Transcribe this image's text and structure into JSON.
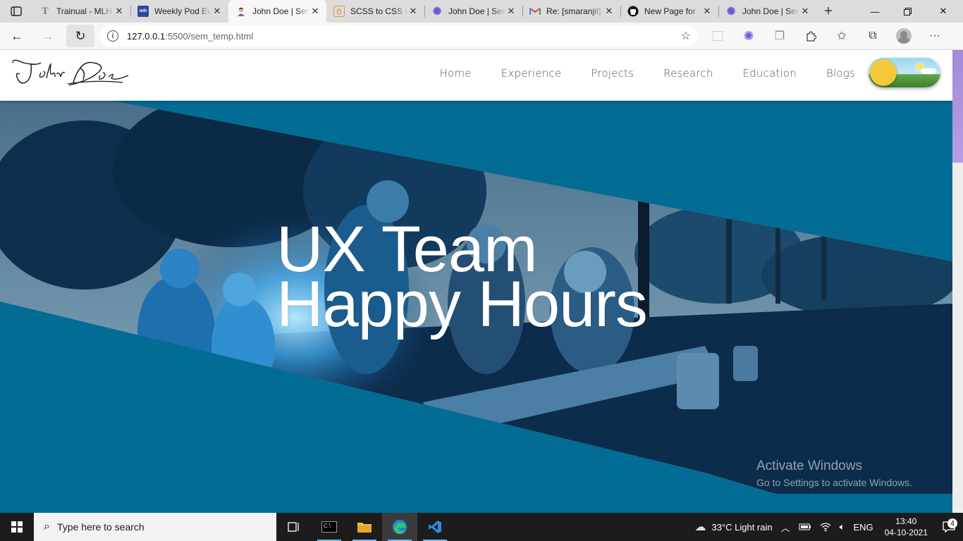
{
  "browser": {
    "tabs": [
      {
        "title": "Trainual - MLH",
        "icon": "trainual-icon",
        "active": false
      },
      {
        "title": "Weekly Pod Events",
        "icon": "mlh-icon",
        "active": false
      },
      {
        "title": "John Doe | Semantics",
        "icon": "person-icon",
        "active": true
      },
      {
        "title": "SCSS to CSS Converter",
        "icon": "code-braces-icon",
        "active": false
      },
      {
        "title": "John Doe | Semantics",
        "icon": "gear-flower-icon",
        "active": false
      },
      {
        "title": "Re: [smaranjit]",
        "icon": "gmail-icon",
        "active": false
      },
      {
        "title": "New Page for",
        "icon": "github-icon",
        "active": false
      },
      {
        "title": "John Doe | Semantics",
        "icon": "gear-flower-icon",
        "active": false
      }
    ],
    "url_host": "127.0.0.1",
    "url_path": ":5500/sem_temp.html"
  },
  "site": {
    "logo_text": "John Doe",
    "nav": [
      "Home",
      "Experience",
      "Projects",
      "Research",
      "Education",
      "Blogs"
    ],
    "hero_line1": "UX Team",
    "hero_line2": "Happy Hours",
    "colors": {
      "hero_bg": "#036c95",
      "toggle_knob": "#f3c83a"
    }
  },
  "watermark": {
    "title": "Activate Windows",
    "subtitle": "Go to Settings to activate Windows."
  },
  "taskbar": {
    "search_placeholder": "Type here to search",
    "weather": "33°C  Light rain",
    "language": "ENG",
    "time": "13:40",
    "date": "04-10-2021",
    "notifications": "4"
  }
}
